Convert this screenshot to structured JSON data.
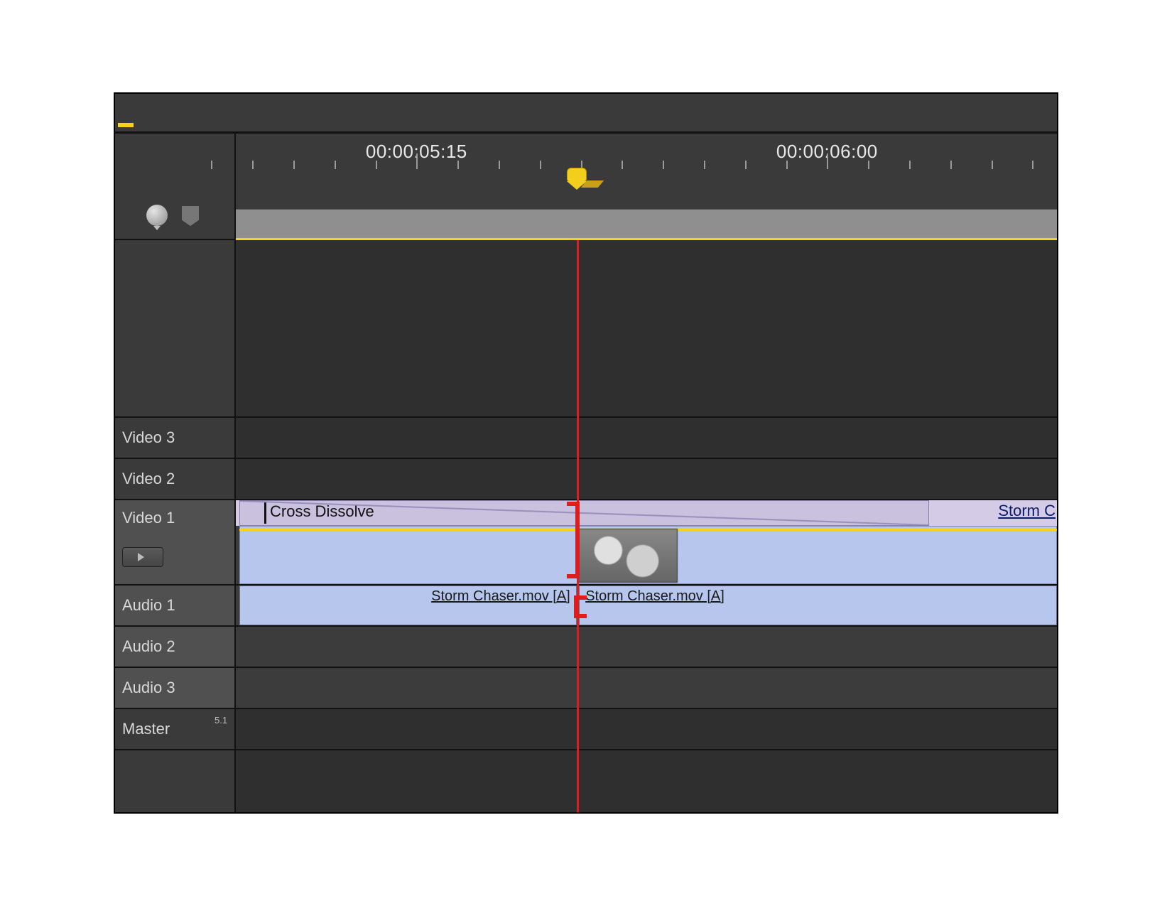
{
  "ruler": {
    "labels": [
      "00:00:05:15",
      "00:00:06:00"
    ],
    "playhead_position_percent": 41.5
  },
  "tracks": {
    "video3": "Video 3",
    "video2": "Video 2",
    "video1": "Video 1",
    "audio1": "Audio 1",
    "audio2": "Audio 2",
    "audio3": "Audio 3",
    "master": "Master",
    "master_sub": "5.1"
  },
  "clips": {
    "transition_name": "Cross Dissolve",
    "v1_right_label": "Storm C",
    "audio1_left": "Storm Chaser.mov [A]",
    "audio1_right": "Storm Chaser.mov [A]"
  },
  "colors": {
    "accent_yellow": "#f7d21a",
    "playhead_red": "#d81e1e",
    "clip_blue": "#b6c6ec",
    "transition_lavender": "#c9c1dd"
  }
}
